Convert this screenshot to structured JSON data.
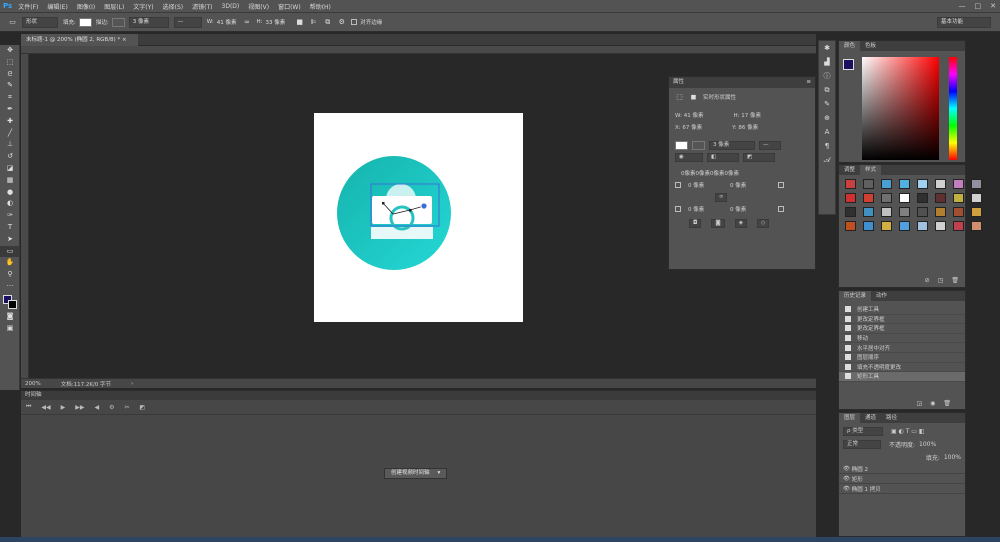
{
  "menu": {
    "app_logo": "Ps",
    "items": [
      "文件(F)",
      "编辑(E)",
      "图像(I)",
      "图层(L)",
      "文字(Y)",
      "选择(S)",
      "滤镜(T)",
      "3D(D)",
      "视图(V)",
      "窗口(W)",
      "帮助(H)"
    ],
    "min": "—",
    "max": "□",
    "close": "✕"
  },
  "options": {
    "mode": "形状",
    "fill_label": "填充:",
    "stroke_label": "描边:",
    "stroke_width": "3 像素",
    "w_label": "W:",
    "w_value": "41 像素",
    "h_label": "H:",
    "h_value": "33 像素",
    "align_edges": "对齐边缘",
    "workspace": "基本功能"
  },
  "doc": {
    "tab_title": "未标题-1 @ 200% (椭圆 2, RGB/8) *",
    "zoom": "200%",
    "info": "文档:117.2K/0 字节"
  },
  "properties": {
    "tab": "属性",
    "section": "实时形状属性",
    "w": "W: 41 像素",
    "h": "H: 17 像素",
    "x": "X: 67 像素",
    "y": "Y: 86 像素",
    "stroke": "3 像素",
    "radius": "0像素0像素0像素0像素",
    "r1": "0 像素",
    "r2": "0 像素",
    "r3": "0 像素",
    "r4": "0 像素"
  },
  "timeline": {
    "tab": "时间轴",
    "create_button": "创建视频时间轴"
  },
  "color": {
    "tab1": "颜色",
    "tab2": "色板",
    "fg": "#1a1060"
  },
  "styles": {
    "tab1": "调整",
    "tab2": "样式",
    "swatches": [
      "#c94040",
      "#606060",
      "#4aa0d0",
      "#50b0e0",
      "#a0d0f0",
      "#d0d0d0",
      "#c080c0",
      "#9090a0",
      "#d03030",
      "#d04030",
      "#707070",
      "#ffffff",
      "#303030",
      "#603030",
      "#c0b040",
      "#d0d0d0",
      "#303030",
      "#4090c0",
      "#c0c0c0",
      "#808080",
      "#505050",
      "#b08030",
      "#a05030",
      "#d0a040",
      "#c05020",
      "#4090d0",
      "#d0b040",
      "#50a0e0",
      "#a0c0e0",
      "#d0d0d0",
      "#c04050",
      "#d09070"
    ]
  },
  "history": {
    "tab1": "历史记录",
    "tab2": "动作",
    "items": [
      "创建工具",
      "更改定界框",
      "更改定界框",
      "移动",
      "水平居中对齐",
      "图层顺序",
      "填充不透明度更改",
      "矩形工具"
    ]
  },
  "layers": {
    "tab1": "图层",
    "tab2": "通道",
    "tab3": "路径",
    "kind": "ρ 类型",
    "blend": "正常",
    "opacity_label": "不透明度:",
    "opacity": "100%",
    "fill_label": "填充:",
    "fill": "100%",
    "rows": [
      "椭圆 2",
      "矩形",
      "椭圆 1 拷贝"
    ]
  },
  "icons": [
    "move-icon",
    "marquee-icon",
    "lasso-icon",
    "quick-select-icon",
    "crop-icon",
    "eyedropper-icon",
    "healing-icon",
    "brush-icon",
    "stamp-icon",
    "history-brush-icon",
    "eraser-icon",
    "gradient-icon",
    "blur-icon",
    "dodge-icon",
    "pen-icon",
    "type-icon",
    "path-select-icon",
    "shape-icon",
    "hand-icon",
    "zoom-icon"
  ]
}
